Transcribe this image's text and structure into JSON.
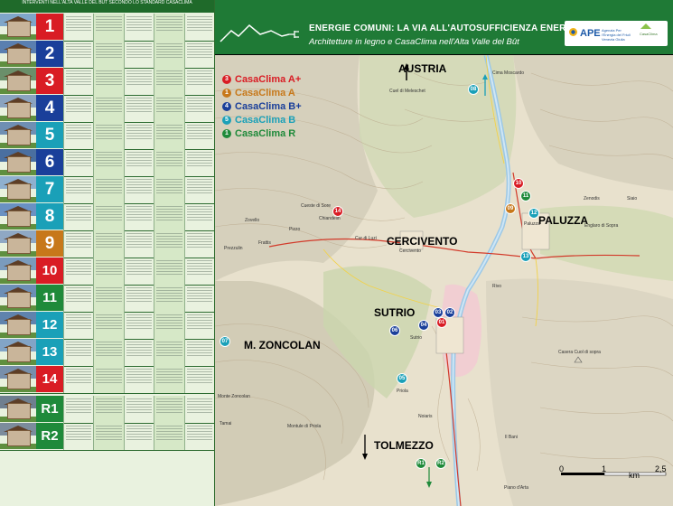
{
  "left_table": {
    "header": "INTERVENTI NELL'ALTA VALLE DEL BÛT SECONDO LO STANDARD CASACLIMA",
    "rows": [
      {
        "label": "1",
        "color": "#d91c24"
      },
      {
        "label": "2",
        "color": "#1a3f9a"
      },
      {
        "label": "3",
        "color": "#d91c24"
      },
      {
        "label": "4",
        "color": "#1a3f9a"
      },
      {
        "label": "5",
        "color": "#1aa0b8"
      },
      {
        "label": "6",
        "color": "#1a3f9a"
      },
      {
        "label": "7",
        "color": "#1aa0b8"
      },
      {
        "label": "8",
        "color": "#1aa0b8"
      },
      {
        "label": "9",
        "color": "#c7781a"
      },
      {
        "label": "10",
        "color": "#d91c24"
      },
      {
        "label": "11",
        "color": "#1f8a3a"
      },
      {
        "label": "12",
        "color": "#1aa0b8"
      },
      {
        "label": "13",
        "color": "#1aa0b8"
      },
      {
        "label": "14",
        "color": "#d91c24"
      },
      {
        "label": "R1",
        "color": "#1f8a3a"
      },
      {
        "label": "R2",
        "color": "#1f8a3a"
      }
    ]
  },
  "header": {
    "title": "ENERGIE COMUNI: LA VIA ALL'AUTOSUFFICIENZA ENERGETICA",
    "subtitle": "Architetture in legno e CasaClima nell'Alta Valle del Bût",
    "logo_ape": "APE",
    "logo_ape_desc": "Agenzia Per l'Energia del Friuli Venezia Giulia",
    "logo_cc": "CasaClima"
  },
  "legend": [
    {
      "num": "3",
      "label": "CasaClima A+",
      "color": "#d91c24"
    },
    {
      "num": "1",
      "label": "CasaClima A",
      "color": "#c7781a"
    },
    {
      "num": "4",
      "label": "CasaClima B+",
      "color": "#1a3f9a"
    },
    {
      "num": "5",
      "label": "CasaClima B",
      "color": "#1aa0b8"
    },
    {
      "num": "1",
      "label": "CasaClima R",
      "color": "#1f8a3a"
    }
  ],
  "places": {
    "austria": "AUSTRIA",
    "cercivento": "CERCIVENTO",
    "paluzza": "PALUZZA",
    "sutrio": "SUTRIO",
    "zoncolan": "M. ZONCOLAN",
    "tolmezzo": "TOLMEZZO"
  },
  "small_places": {
    "cima_mirscardo": "Cima Moscardo",
    "cuel_di_meleschet": "Cuel di Meleschet",
    "zovello": "Zovello",
    "frattis": "Frattis",
    "chiandelin": "Chiandelin",
    "cueste_di_sore": "Cueste di Sore",
    "pizzo": "Pizzo",
    "prezzulin": "Prezzulin",
    "cur_di_lus": "Cur di Luzi",
    "zenodis": "Zenodis",
    "siaio": "Siaio",
    "englaro": "Englaro di Sopra",
    "rivo": "Rivo",
    "sutrio_town": "Sutrio",
    "priola": "Priola",
    "noiaris": "Noiaris",
    "monte_zoncolan": "Monte Zoncolan",
    "tamai": "Tamai",
    "montule": "Montule di Priola",
    "casera": "Casera Cuol di sopra",
    "piano_arta": "Piano d'Arta",
    "il_bani": "Il Bani",
    "paluzza_small": "Paluzza",
    "cercivento_small": "Cercivento"
  },
  "markers": [
    {
      "num": "08",
      "color": "#1aa0b8"
    },
    {
      "num": "10",
      "color": "#d91c24"
    },
    {
      "num": "11",
      "color": "#1f8a3a"
    },
    {
      "num": "09",
      "color": "#c7781a"
    },
    {
      "num": "12",
      "color": "#1aa0b8"
    },
    {
      "num": "14",
      "color": "#d91c24"
    },
    {
      "num": "13",
      "color": "#1aa0b8"
    },
    {
      "num": "03",
      "color": "#1a3f9a"
    },
    {
      "num": "02",
      "color": "#1a3f9a"
    },
    {
      "num": "01",
      "color": "#d91c24"
    },
    {
      "num": "04",
      "color": "#1a3f9a"
    },
    {
      "num": "06",
      "color": "#1a3f9a"
    },
    {
      "num": "07",
      "color": "#1aa0b8"
    },
    {
      "num": "05",
      "color": "#1aa0b8"
    },
    {
      "num": "R1",
      "color": "#1f8a3a"
    },
    {
      "num": "R2",
      "color": "#1f8a3a"
    }
  ],
  "scale": {
    "zero": "0",
    "one": "1",
    "km": "km",
    "max": "2,5"
  }
}
